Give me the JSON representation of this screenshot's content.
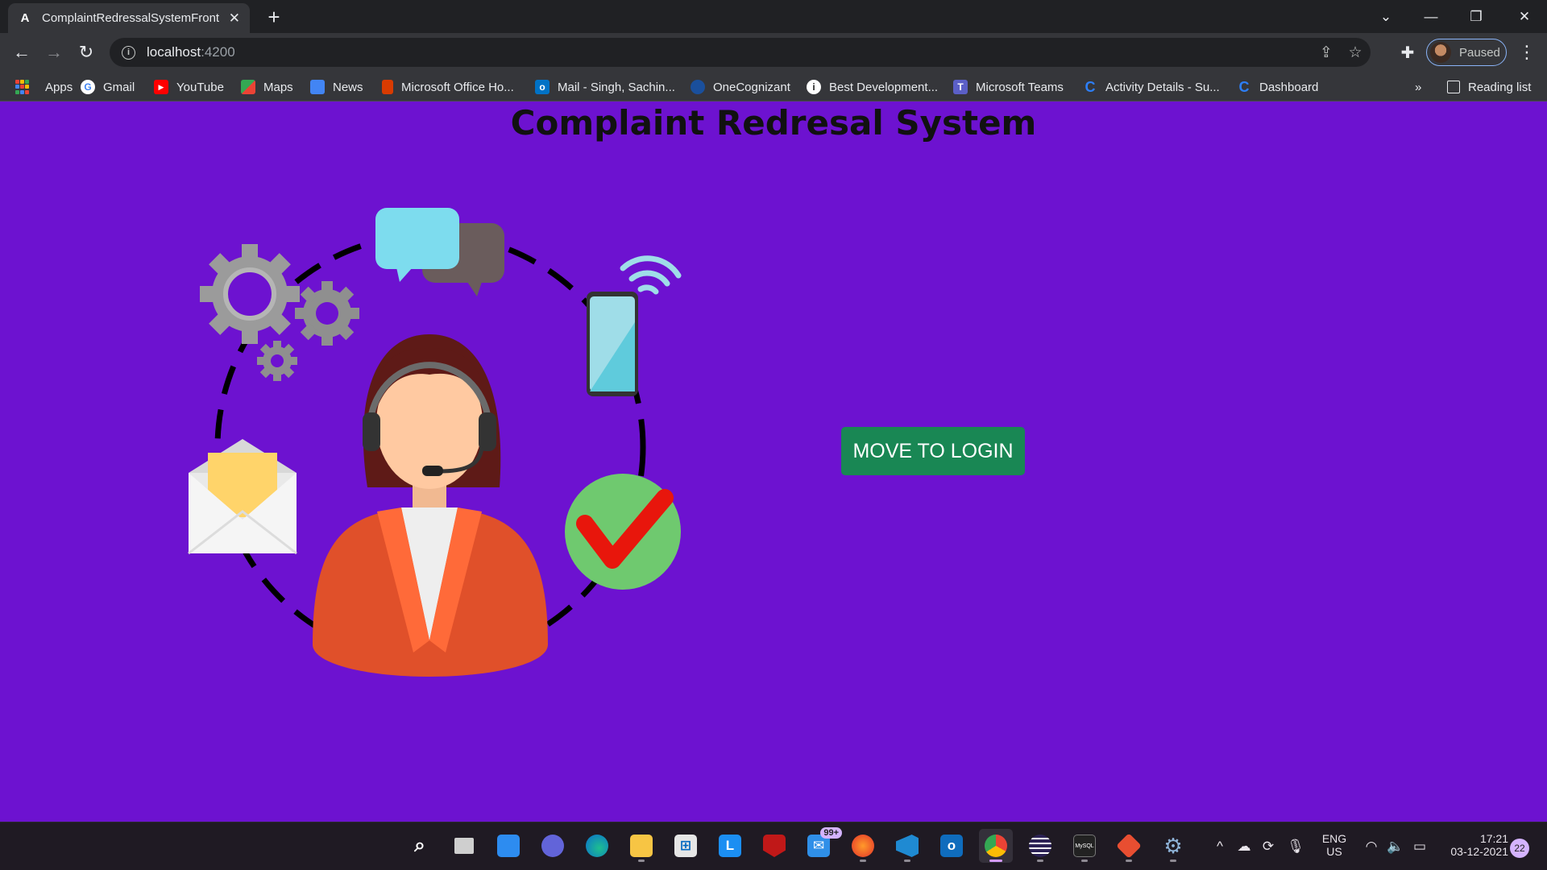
{
  "browser": {
    "tab_title": "ComplaintRedressalSystemFrontend",
    "tab_favicon_letter": "A",
    "new_tab": "+",
    "url_host": "localhost",
    "url_port": ":4200",
    "profile_label": "Paused",
    "window_controls": [
      "chevron-down-icon",
      "minimize-icon",
      "restore-icon",
      "close-icon"
    ]
  },
  "bookmarks": [
    {
      "label": "Apps",
      "icon": "apps-grid-icon"
    },
    {
      "label": "Gmail",
      "icon": "google-icon",
      "color": "#ffffff"
    },
    {
      "label": "YouTube",
      "icon": "youtube-icon",
      "color": "#ff0000"
    },
    {
      "label": "Maps",
      "icon": "maps-icon",
      "color": "#34a853"
    },
    {
      "label": "News",
      "icon": "news-icon",
      "color": "#4285f4"
    },
    {
      "label": "Microsoft Office Ho...",
      "icon": "office-icon",
      "color": "#d83b01"
    },
    {
      "label": "Mail - Singh, Sachin...",
      "icon": "outlook-icon",
      "color": "#0072c6"
    },
    {
      "label": "OneCognizant",
      "icon": "onecognizant-icon",
      "color": "#1a4f9c"
    },
    {
      "label": "Best Development...",
      "icon": "best-dev-icon",
      "color": "#ffffff"
    },
    {
      "label": "Microsoft Teams",
      "icon": "teams-icon",
      "color": "#5b5fc7"
    },
    {
      "label": "Activity Details - Su...",
      "icon": "cognizant-c-icon",
      "color": "#2d7ff9"
    },
    {
      "label": "Dashboard",
      "icon": "cognizant-c-icon",
      "color": "#2d7ff9"
    }
  ],
  "bookmarks_overflow": "»",
  "reading_list": "Reading list",
  "page": {
    "title": "Complaint Redresal System",
    "login_button": "MOVE TO LOGIN",
    "accent_color": "#6d12d0",
    "button_color": "#198754"
  },
  "taskbar": {
    "apps": [
      {
        "name": "start-button",
        "icon": "windows-icon"
      },
      {
        "name": "search-button",
        "icon": "search-icon"
      },
      {
        "name": "task-view-button",
        "icon": "task-view-icon"
      },
      {
        "name": "widgets-button",
        "icon": "widgets-icon"
      },
      {
        "name": "teams-chat-button",
        "icon": "chat-icon"
      },
      {
        "name": "edge-button",
        "icon": "edge-icon"
      },
      {
        "name": "file-explorer-button",
        "icon": "folder-icon"
      },
      {
        "name": "store-button",
        "icon": "store-icon"
      },
      {
        "name": "l-app-button",
        "icon": "l-app-icon",
        "label": "L"
      },
      {
        "name": "mcafee-button",
        "icon": "mcafee-icon"
      },
      {
        "name": "mail-button",
        "icon": "mail-icon",
        "badge": "99+"
      },
      {
        "name": "firefox-button",
        "icon": "firefox-icon"
      },
      {
        "name": "vscode-button",
        "icon": "vscode-icon"
      },
      {
        "name": "outlook-button",
        "icon": "outlook-icon"
      },
      {
        "name": "chrome-button",
        "icon": "chrome-icon",
        "active": true
      },
      {
        "name": "eclipse-button",
        "icon": "eclipse-icon"
      },
      {
        "name": "mysql-button",
        "icon": "mysql-icon",
        "label": "MySQL"
      },
      {
        "name": "git-button",
        "icon": "git-icon"
      },
      {
        "name": "settings-button",
        "icon": "gear-icon"
      }
    ],
    "language": "ENG",
    "region": "US",
    "time": "17:21",
    "date": "03-12-2021",
    "notifications": "22"
  }
}
